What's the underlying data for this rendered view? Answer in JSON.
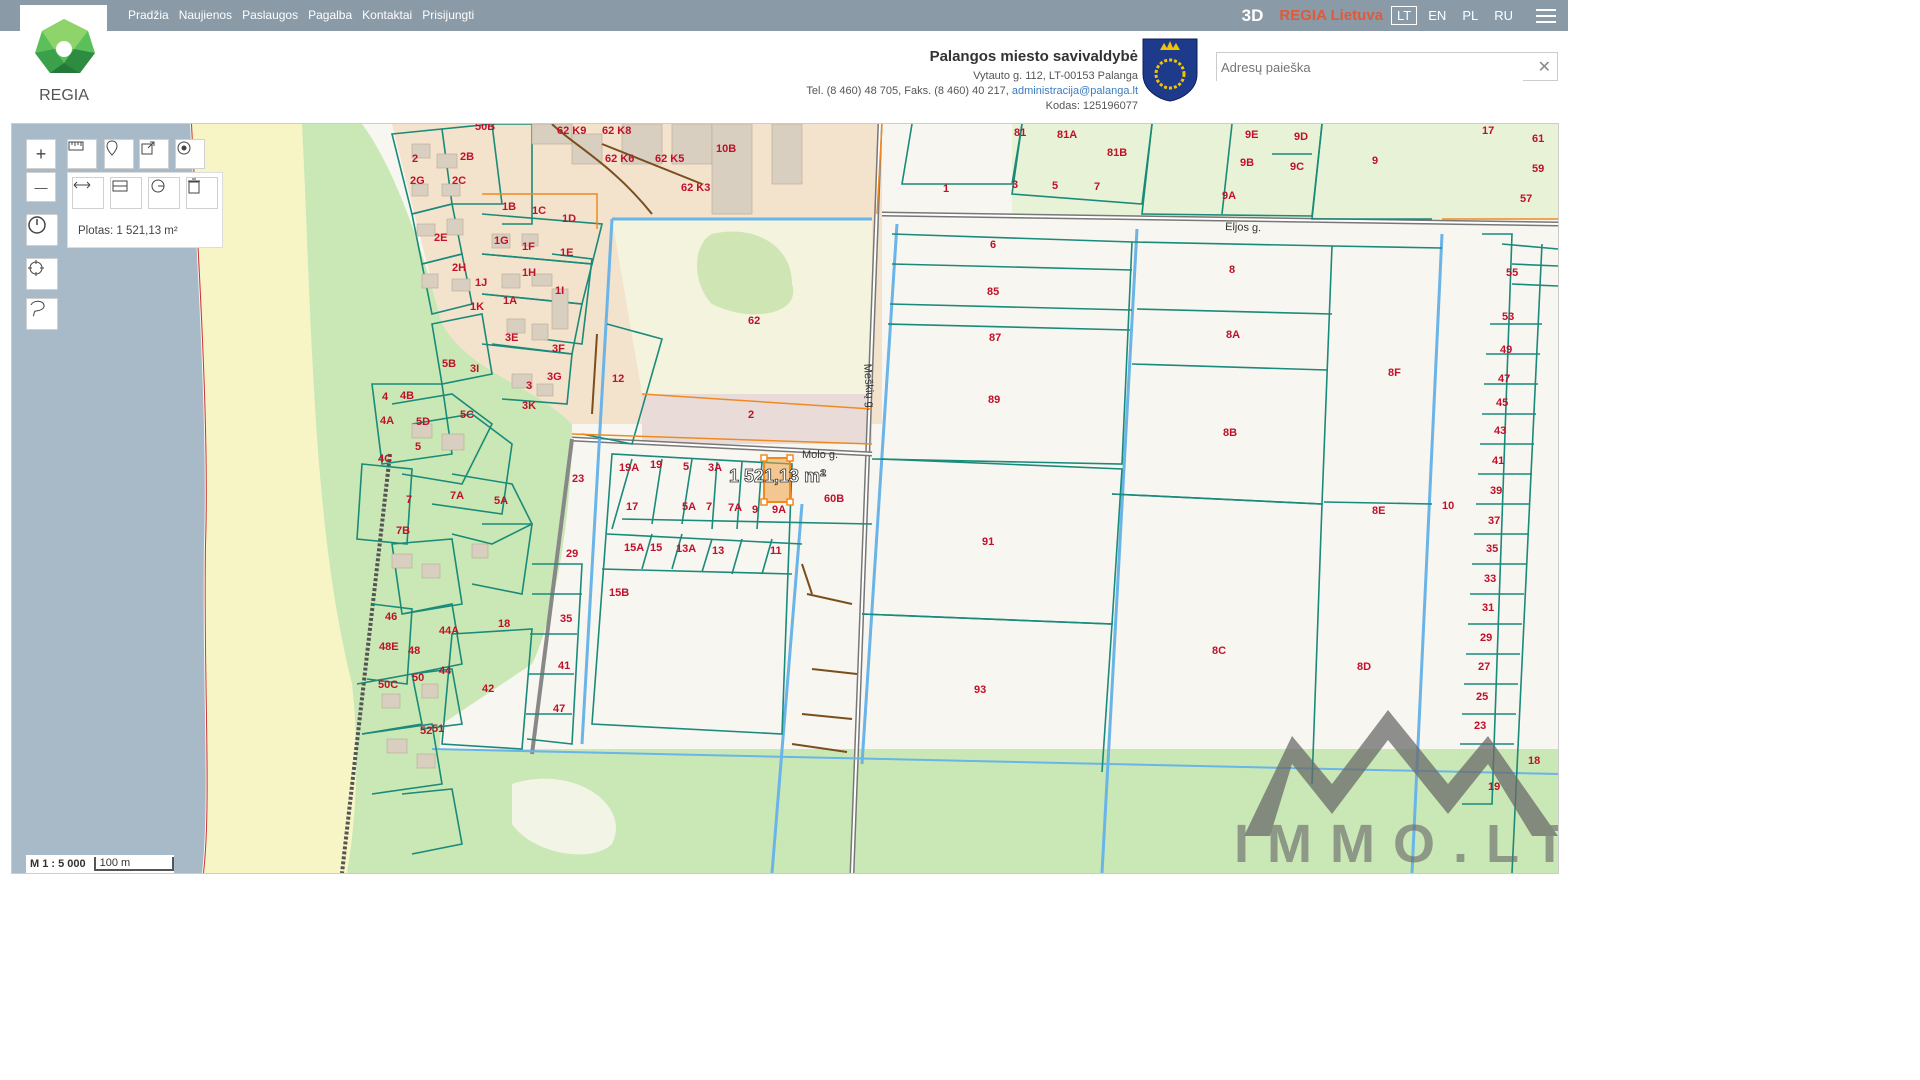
{
  "nav": {
    "items": [
      "Pradžia",
      "Naujienos",
      "Paslaugos",
      "Pagalba",
      "Kontaktai",
      "Prisijungti"
    ],
    "three_d": "3D",
    "brand": "REGIA Lietuva",
    "languages": [
      "LT",
      "EN",
      "PL",
      "RU"
    ],
    "active_language": "LT"
  },
  "logo": {
    "text": "REGIA"
  },
  "municipality": {
    "name": "Palangos miesto savivaldybė",
    "address": "Vytauto g. 112, LT-00153 Palanga",
    "phones": "Tel. (8 460) 48 705, Faks. (8 460) 40 217,",
    "email": "administracija@palanga.lt",
    "code": "Kodas: 125196077"
  },
  "search": {
    "placeholder": "Adresų paieška",
    "clear": "✕"
  },
  "tools": {
    "zoom_in": "+",
    "zoom_out": "—",
    "area_text": "Plotas: 1 521,13 m²"
  },
  "map": {
    "scale_ratio": "M 1 : 5 000",
    "scale_bar": "100 m",
    "measurement": "1 521,13 m²",
    "streets": [
      "Eljos g.",
      "Molo g.",
      "Meškių g."
    ],
    "parcel_labels": [
      "2",
      "2B",
      "2C",
      "2G",
      "2E",
      "2H",
      "50B",
      "1B",
      "1C",
      "1D",
      "1G",
      "1F",
      "1E",
      "1H",
      "1I",
      "1A",
      "1J",
      "1K",
      "3E",
      "3F",
      "3G",
      "3I",
      "3",
      "3K",
      "5B",
      "4",
      "4B",
      "4A",
      "4C",
      "5",
      "5D",
      "5C",
      "7",
      "7A",
      "7B",
      "5A",
      "62 K9",
      "62 K8",
      "62 K6",
      "62 K5",
      "62 K3",
      "10B",
      "62",
      "12",
      "2",
      "81",
      "81A",
      "81B",
      "1",
      "3",
      "5",
      "7",
      "9E",
      "9D",
      "9B",
      "9C",
      "9",
      "9A",
      "17",
      "61",
      "59",
      "57",
      "55",
      "53",
      "49",
      "47",
      "45",
      "43",
      "41",
      "39",
      "37",
      "35",
      "33",
      "31",
      "29",
      "27",
      "25",
      "23",
      "19",
      "18",
      "6",
      "8",
      "85",
      "87",
      "8A",
      "89",
      "8F",
      "8B",
      "8E",
      "10",
      "91",
      "8C",
      "8D",
      "93",
      "19A",
      "19",
      "5",
      "3A",
      "60B",
      "17",
      "5A",
      "7",
      "7A",
      "9",
      "9A",
      "15A",
      "15",
      "13A",
      "13",
      "11",
      "15B",
      "23",
      "29",
      "35",
      "41",
      "47",
      "18",
      "42",
      "46",
      "48E",
      "48",
      "44A",
      "44",
      "50C",
      "50",
      "52",
      "51"
    ],
    "watermark": "IMMO.LT"
  },
  "colors": {
    "topbar": "#8a9aa7",
    "sea": "#a8bac8",
    "beach": "#f7f4c6",
    "forest": "#c9e8b5",
    "parcel_line": "#1a8a7a",
    "label": "#c0102a",
    "highlight": "#f08a20"
  }
}
